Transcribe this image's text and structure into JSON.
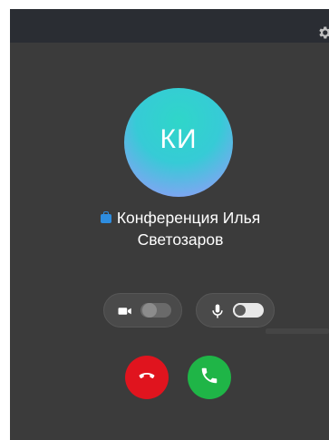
{
  "caller": {
    "initials": "КИ",
    "name_line1": "Конференция Илья",
    "name_line2": "Светозаров",
    "badge_icon": "briefcase-icon",
    "badge_color": "#2e8de0"
  },
  "controls": {
    "video_icon": "video-camera-icon",
    "mic_icon": "microphone-icon",
    "video_enabled": false,
    "mic_enabled": true
  },
  "actions": {
    "decline_icon": "phone-hangup-icon",
    "accept_icon": "phone-icon",
    "decline_color": "#e0141e",
    "accept_color": "#1fb547"
  },
  "header": {
    "settings_icon": "gear-icon"
  },
  "colors": {
    "window_bg": "#3b3b3b",
    "titlebar_bg": "#2a2d33"
  }
}
